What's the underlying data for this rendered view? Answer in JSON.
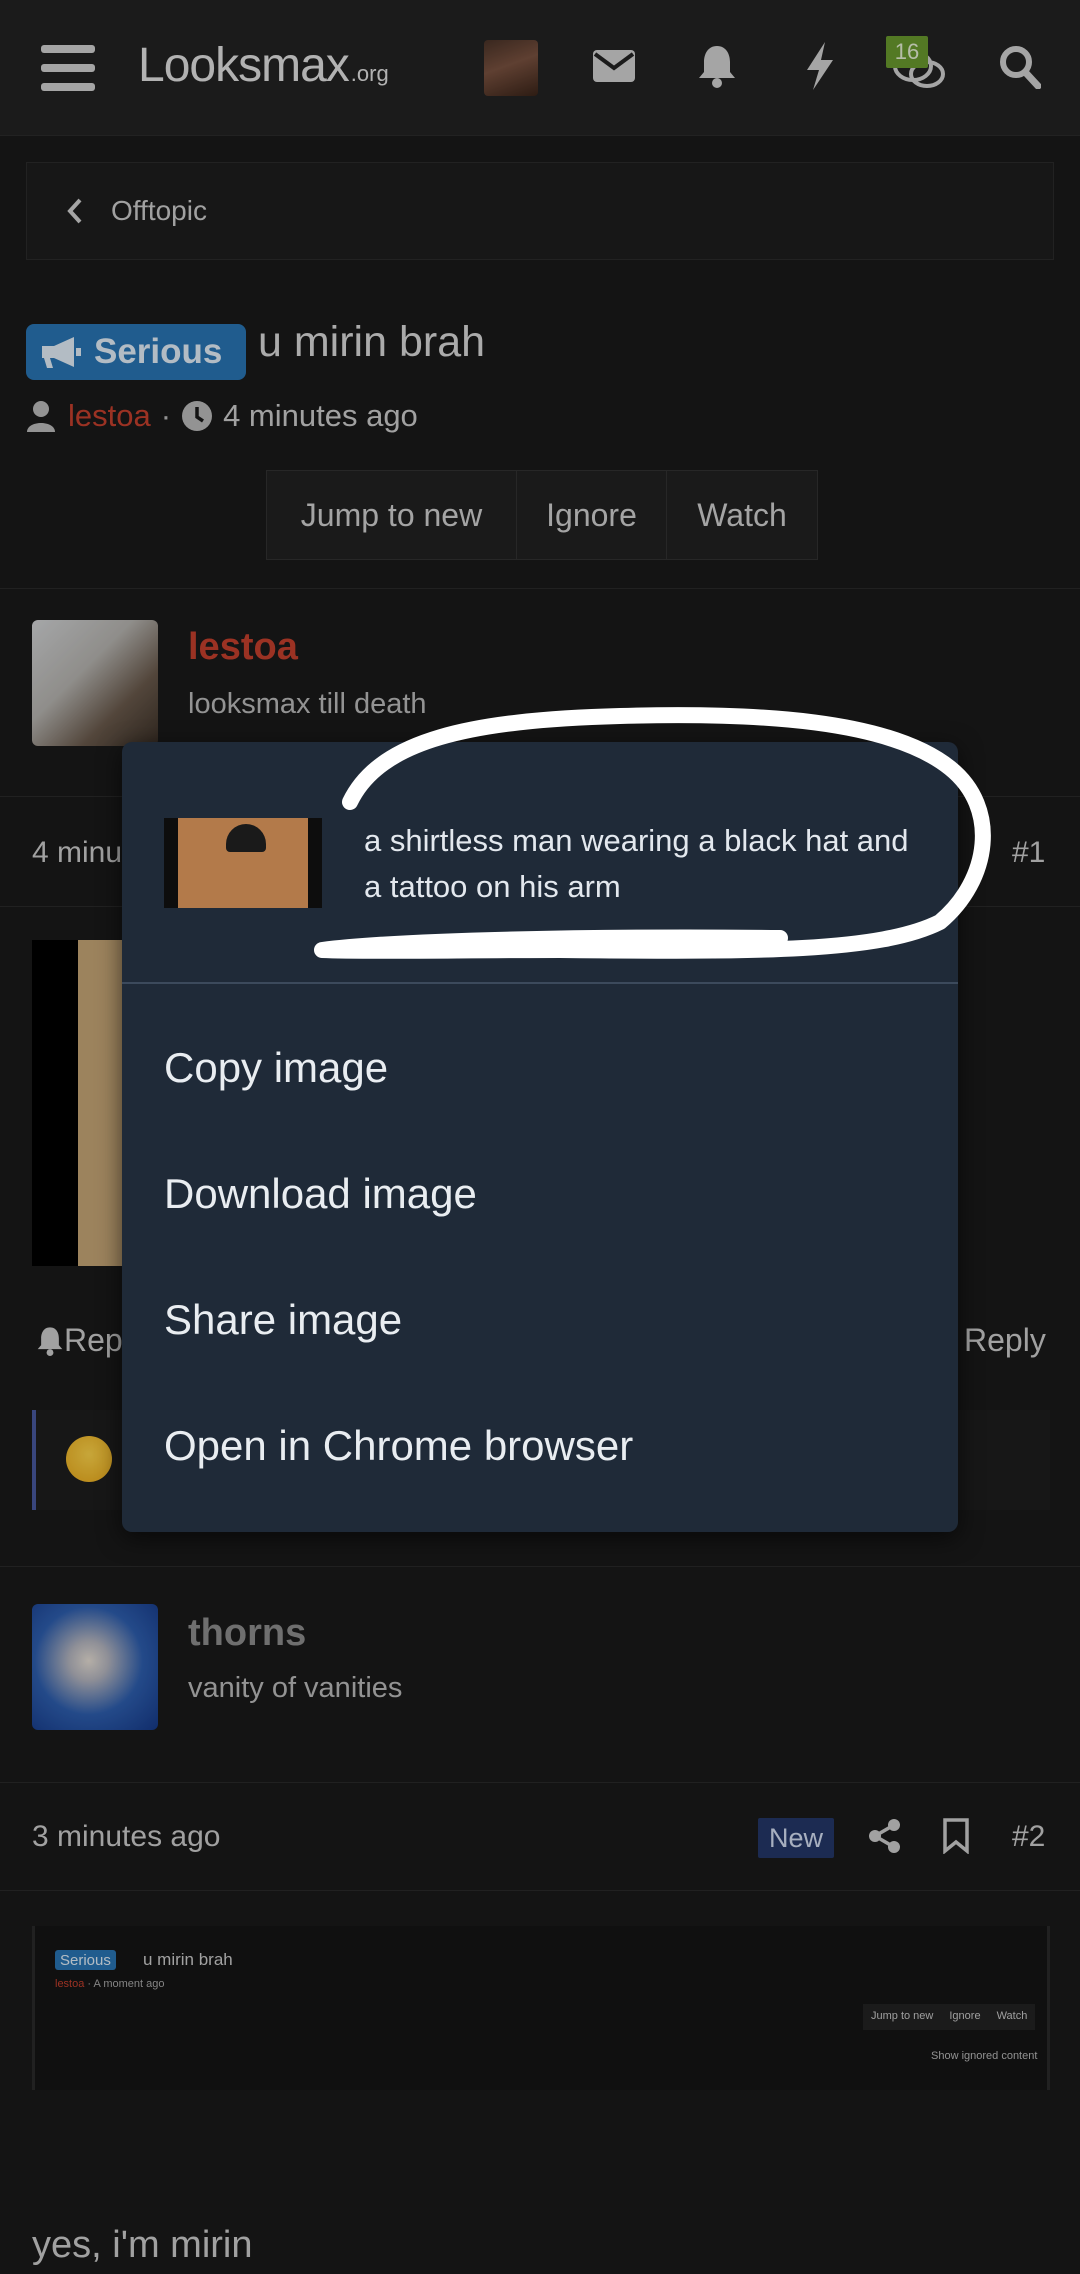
{
  "header": {
    "logo_main": "Looksmax",
    "logo_sub": ".org",
    "notif_count": "16",
    "icons": [
      "menu-icon",
      "envelope-icon",
      "bell-icon",
      "bolt-icon",
      "comments-icon",
      "search-icon"
    ]
  },
  "breadcrumb": {
    "label": "Offtopic"
  },
  "thread": {
    "prefix": "Serious",
    "title": "u mirin brah",
    "author": "lestoa",
    "time": "4 minutes ago",
    "buttons": [
      "Jump to new",
      "Ignore",
      "Watch"
    ]
  },
  "posts": [
    {
      "username": "lestoa",
      "user_title": "looksmax till death",
      "time": "4 minu",
      "number": "#1",
      "report_label": "Rep",
      "reply_label": "Reply"
    },
    {
      "username": "thorns",
      "user_title": "vanity of vanities",
      "time": "3 minutes ago",
      "new_label": "New",
      "number": "#2",
      "quoted": {
        "prefix": "Serious",
        "title": "u mirin brah",
        "author": "lestoa",
        "time": "A moment ago",
        "buttons": [
          "Jump to new",
          "Ignore",
          "Watch"
        ],
        "ignored": "Show ignored content"
      },
      "text": "yes, i'm mirin"
    }
  ],
  "context_menu": {
    "caption": "a shirtless man wearing a black hat and a tattoo on his arm",
    "items": [
      "Copy image",
      "Download image",
      "Share image",
      "Open in Chrome browser"
    ]
  },
  "colors": {
    "background": "#1a1a1a",
    "accent_red": "#c7402e",
    "prefix_blue": "#2a77b6",
    "menu_bg": "#1f2a38",
    "badge_green": "#6b9c2f"
  }
}
